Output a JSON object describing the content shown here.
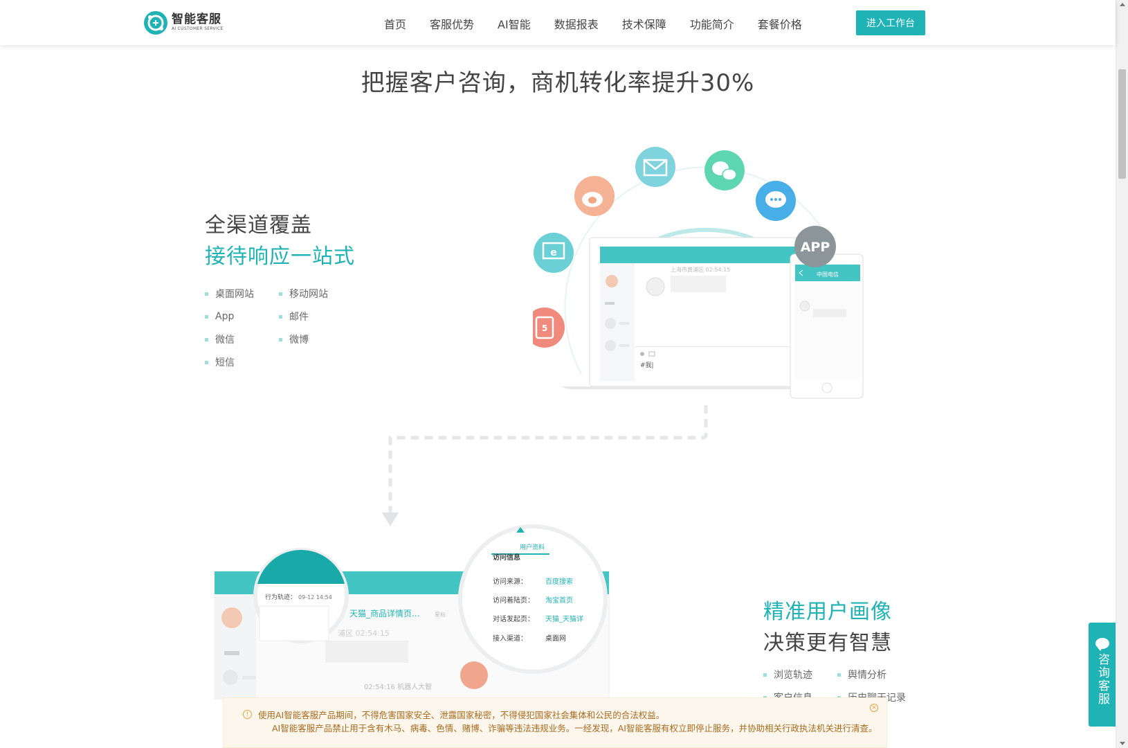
{
  "brand": {
    "name": "智能客服",
    "tagline": "AI CUSTOMER SERVICE"
  },
  "nav": {
    "items": [
      "首页",
      "客服优势",
      "AI智能",
      "数据报表",
      "技术保障",
      "功能简介",
      "套餐价格"
    ]
  },
  "cta": {
    "label": "进入工作台"
  },
  "hero": {
    "title": "把握客户咨询，商机转化率提升30%"
  },
  "section_channels": {
    "title_line1": "全渠道覆盖",
    "title_line2": "接待响应一站式",
    "features": [
      "桌面网站",
      "移动网站",
      "App",
      "邮件",
      "微信",
      "微博",
      "短信"
    ],
    "app_badge": "APP",
    "screen": {
      "location_text": "上海市黄浦区 02:54:15",
      "input_text": "#我|",
      "phone_title": "中国电信"
    }
  },
  "section_portrait": {
    "title_line1": "精准用户画像",
    "title_line2": "决策更有智慧",
    "features": [
      "浏览轨迹",
      "舆情分析",
      "客户信息",
      "历史聊天记录"
    ],
    "screen": {
      "track_label": "行为轨迹：",
      "track_time": "09-12 14:54",
      "product_link": "天猫_商品详情页...",
      "star_label": "星标",
      "location_text": "浦区 02:54:15",
      "bot_line": "02:54:16  机器人大智",
      "tab_label": "用户资料",
      "section_label": "访问信息",
      "rows": [
        {
          "label": "访问来源：",
          "value": "百度搜索"
        },
        {
          "label": "访问着陆页：",
          "value": "淘宝首页"
        },
        {
          "label": "对话发起页：",
          "value": "天猫_天猫详"
        },
        {
          "label": "接入渠道：",
          "value": "桌面网"
        }
      ]
    }
  },
  "float_button": {
    "label": "咨询客服"
  },
  "notice": {
    "line1": "使用AI智能客服产品期间，不得危害国家安全、泄露国家秘密，不得侵犯国家社会集体和公民的合法权益。",
    "line2": "AI智能客服产品禁止用于含有木马、病毒、色情、赌博、诈骗等违法违规业务。一经发现，AI智能客服有权立即停止服务，并协助相关行政执法机关进行清查。"
  },
  "colors": {
    "brand": "#1fb3b5",
    "text": "#333333",
    "notice_bg": "#fdf6ec",
    "notice_text": "#a66b1e"
  }
}
